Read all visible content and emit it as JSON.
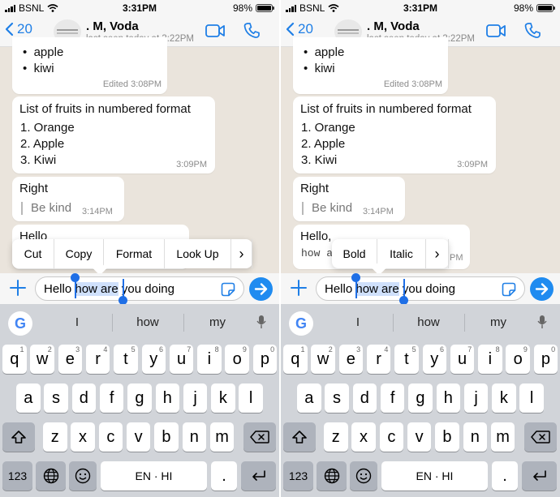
{
  "status": {
    "carrier": "BSNL",
    "time": "3:31PM",
    "battery": "98%",
    "battery_level": 0.98
  },
  "header": {
    "back_count": "20",
    "name": ". M, Voda",
    "last_seen": "last seen today at 3:22PM"
  },
  "messages": {
    "list_items": [
      "apple",
      "kiwi"
    ],
    "list_meta": "Edited 3:08PM",
    "numbered_title": "List of fruits in numbered format",
    "numbered_items": [
      "1. Orange",
      "2. Apple",
      "3. Kiwi"
    ],
    "numbered_time": "3:09PM",
    "right_text": "Right",
    "right_quote": "Be kind",
    "right_time": "3:14PM",
    "hello_left": "Hello",
    "hello_right": "Hello,",
    "hello_right_mono": "how a",
    "hello_right_time": "PM"
  },
  "composer": {
    "text_before": "Hello ",
    "text_selected": "how are",
    "text_after": " you doing"
  },
  "menu_left": {
    "items": [
      "Cut",
      "Copy",
      "Format",
      "Look Up"
    ],
    "more": "›"
  },
  "menu_right": {
    "items": [
      "Bold",
      "Italic"
    ],
    "more": "›"
  },
  "keyboard": {
    "suggestions": [
      "I",
      "how",
      "my"
    ],
    "google_logo": "G",
    "row1": [
      "q",
      "w",
      "e",
      "r",
      "t",
      "y",
      "u",
      "i",
      "o",
      "p"
    ],
    "row1_nums": [
      "1",
      "2",
      "3",
      "4",
      "5",
      "6",
      "7",
      "8",
      "9",
      "0"
    ],
    "row2": [
      "a",
      "s",
      "d",
      "f",
      "g",
      "h",
      "j",
      "k",
      "l"
    ],
    "row3": [
      "z",
      "x",
      "c",
      "v",
      "b",
      "n",
      "m"
    ],
    "num_key": "123",
    "space": "EN · HI",
    "period": "."
  },
  "colors": {
    "accent": "#1f7fe6",
    "send": "#1f8bf0",
    "selection": "#cfe0fb",
    "chat_bg": "#eae4dc"
  },
  "icons": [
    "signal-icon",
    "wifi-icon",
    "battery-icon",
    "chevron-left-icon",
    "video-call-icon",
    "phone-icon",
    "plus-icon",
    "sticker-icon",
    "send-icon",
    "globe-icon",
    "emoji-icon",
    "mic-icon",
    "shift-icon",
    "backspace-icon",
    "return-icon"
  ]
}
